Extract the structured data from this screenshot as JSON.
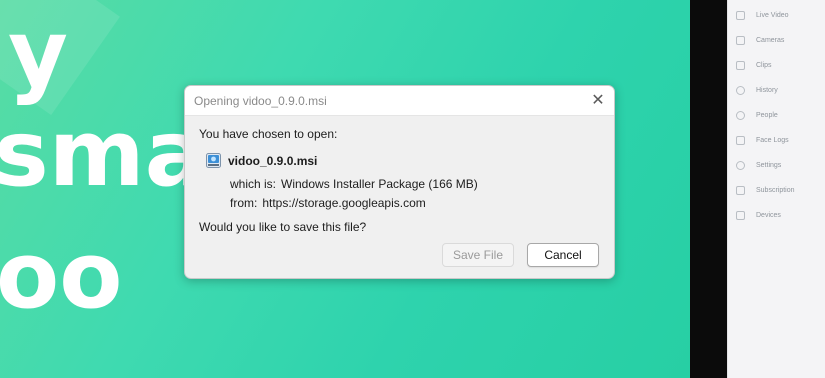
{
  "hero": {
    "line1": "y",
    "line2": "sma",
    "line3": "oo"
  },
  "sidebar": {
    "items": [
      {
        "label": "Live Video",
        "icon": "video-icon"
      },
      {
        "label": "Cameras",
        "icon": "camera-icon"
      },
      {
        "label": "Clips",
        "icon": "clips-icon"
      },
      {
        "label": "History",
        "icon": "history-icon"
      },
      {
        "label": "People",
        "icon": "people-icon"
      },
      {
        "label": "Face Logs",
        "icon": "face-logs-icon"
      },
      {
        "label": "Settings",
        "icon": "settings-icon"
      },
      {
        "label": "Subscription",
        "icon": "subscription-icon"
      },
      {
        "label": "Devices",
        "icon": "devices-icon"
      }
    ]
  },
  "dialog": {
    "title": "Opening vidoo_0.9.0.msi",
    "close_glyph": "✕",
    "chosen_label": "You have chosen to open:",
    "file_name": "vidoo_0.9.0.msi",
    "which_is_label": "which is:",
    "which_is_value": "Windows Installer Package (166 MB)",
    "from_label": "from:",
    "from_value": "https://storage.googleapis.com",
    "question": "Would you like to save this file?",
    "save_label": "Save File",
    "cancel_label": "Cancel"
  },
  "colors": {
    "hero_green": "#2fd3a8",
    "divider": "#0b0b0b",
    "sidebar_bg": "#f4f4f6",
    "dialog_bg": "#f0f0f0"
  }
}
